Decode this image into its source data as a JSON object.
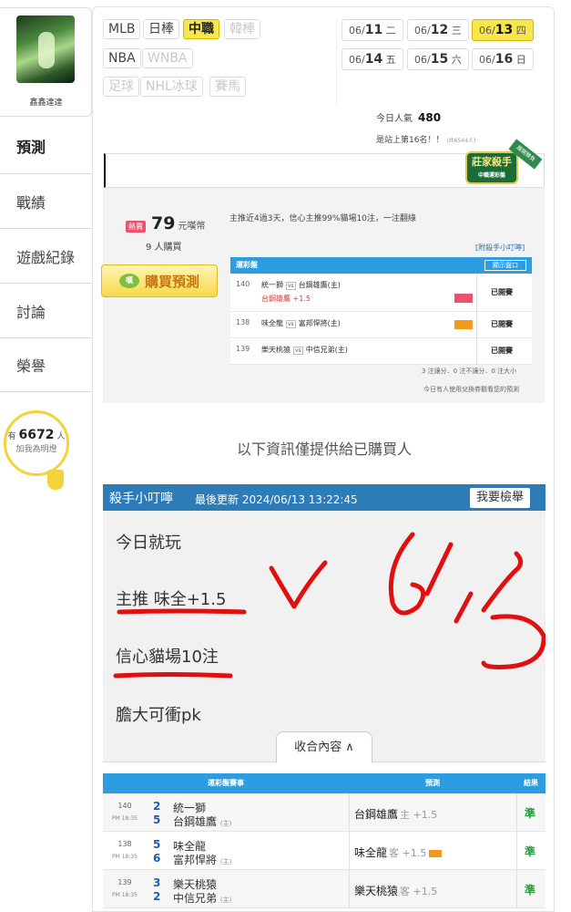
{
  "user": {
    "name": "鑫鑫達達"
  },
  "nav": {
    "items": [
      {
        "label": "預測"
      },
      {
        "label": "戰績"
      },
      {
        "label": "遊戲紀錄"
      },
      {
        "label": "討論"
      },
      {
        "label": "榮譽"
      }
    ]
  },
  "fans": {
    "prefix": "有",
    "count": "6672",
    "suffix": "人",
    "cta": "加我為明燈"
  },
  "leagues": {
    "row1": [
      "MLB",
      "日棒",
      "中職",
      "韓棒"
    ],
    "row2": [
      "NBA",
      "WNBA"
    ],
    "row3": [
      "足球",
      "NHL冰球",
      "賽馬"
    ],
    "active": "中職"
  },
  "dates": [
    {
      "md": "06/",
      "d": "11",
      "wd": "二"
    },
    {
      "md": "06/",
      "d": "12",
      "wd": "三"
    },
    {
      "md": "06/",
      "d": "13",
      "wd": "四"
    },
    {
      "md": "06/",
      "d": "14",
      "wd": "五"
    },
    {
      "md": "06/",
      "d": "15",
      "wd": "六"
    },
    {
      "md": "06/",
      "d": "16",
      "wd": "日"
    }
  ],
  "stats": {
    "popularity_label": "今日人氣",
    "popularity": "480",
    "rank_text": "是站上第16名！！",
    "rank_small": "(共6544人)"
  },
  "badge": {
    "title": "莊家殺手",
    "sub": "中職運彩盤",
    "ribbon": "展開勝負"
  },
  "preview": {
    "hot": "熱賣",
    "price": "79",
    "price_unit": "元嘆幣",
    "buyers": "9 人購買",
    "buy_label": "購買預測",
    "coin_label": "嘆",
    "summary": "主推近4過3天，信心主推99%貓場10注，一注翻綠",
    "ask_link": "[附殺手小叮嚀]",
    "table_title": "運彩盤",
    "show_btn": "顯示盤口",
    "rows": [
      {
        "no": "140",
        "away": "統一獅",
        "vs": "vs",
        "home": "台鋼雄鷹(主)",
        "pick": "台鋼雄鷹 +1.5",
        "status": "已開賽"
      },
      {
        "no": "138",
        "away": "味全龍",
        "vs": "vs",
        "home": "富邦悍將(主)",
        "pick": "",
        "status": "已開賽"
      },
      {
        "no": "139",
        "away": "樂天桃猿",
        "vs": "vs",
        "home": "中信兄弟(主)",
        "pick": "",
        "status": "已開賽"
      }
    ],
    "foot1": "3 注讓分．0 注不讓分．0 注大小",
    "foot2": "今日有人使用兌換券觀看您的預測"
  },
  "buyers_only": "以下資訊僅提供給已購買人",
  "note": {
    "title": "殺手小叮嚀",
    "updated": "最後更新 2024/06/13 13:22:45",
    "report": "我要檢舉",
    "lines": [
      "今日就玩",
      "主推 味全+1.5",
      "信心貓場10注",
      "膽大可衝pk"
    ],
    "collapse": "收合內容 ∧"
  },
  "result": {
    "headers": {
      "game": "運彩盤賽事",
      "pick": "預測",
      "result": "結果"
    },
    "rows": [
      {
        "no": "140",
        "time": "PM 18:35",
        "s1": "2",
        "t1": "統一獅",
        "s2": "5",
        "t2": "台鋼雄鷹",
        "home_mark": "(主)",
        "pick": "台鋼雄鷹",
        "side": "主 +1.5",
        "res": "準"
      },
      {
        "no": "138",
        "time": "PM 18:35",
        "s1": "5",
        "t1": "味全龍",
        "s2": "6",
        "t2": "富邦悍將",
        "home_mark": "(主)",
        "pick": "味全龍",
        "side": "客 +1.5",
        "res": "準"
      },
      {
        "no": "139",
        "time": "PM 18:35",
        "s1": "3",
        "t1": "樂天桃猿",
        "s2": "2",
        "t2": "中信兄弟",
        "home_mark": "(主)",
        "pick": "樂天桃猿",
        "side": "客 +1.5",
        "res": "準"
      }
    ]
  },
  "colors": {
    "accent": "#2b9de0",
    "note_head": "#2d7cb8",
    "active_pill": "#f7e64d",
    "win": "#2a9b3e",
    "ink": "#e01010"
  }
}
